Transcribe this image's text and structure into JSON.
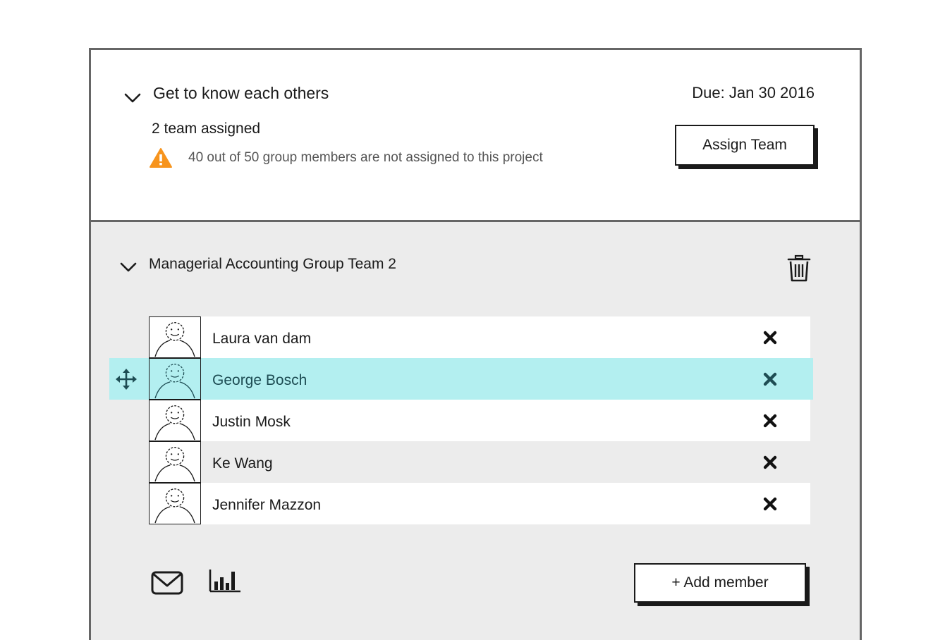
{
  "project": {
    "title": "Get to know each others",
    "due": "Due: Jan 30 2016",
    "team_count": "2 team assigned",
    "warning": "40 out of 50 group members are not assigned to this project",
    "assign_button": "Assign Team"
  },
  "team": {
    "title": "Managerial Accounting Group Team 2",
    "members": [
      {
        "name": "Laura van dam"
      },
      {
        "name": "George Bosch",
        "highlighted": true
      },
      {
        "name": "Justin Mosk"
      },
      {
        "name": "Ke Wang"
      },
      {
        "name": "Jennifer Mazzon"
      }
    ],
    "add_member_button": "+ Add member"
  },
  "colors": {
    "highlight": "#b3eff0",
    "warning": "#f7941d",
    "border": "#666666",
    "panel_bg": "#ececec"
  },
  "icons": {
    "collapse": "chevron-down-icon",
    "warning": "warning-triangle-icon",
    "delete_team": "trash-icon",
    "avatar": "person-avatar-icon",
    "remove_member": "close-icon",
    "drag": "move-handle-icon",
    "mail": "mail-icon",
    "stats": "bar-chart-icon"
  }
}
